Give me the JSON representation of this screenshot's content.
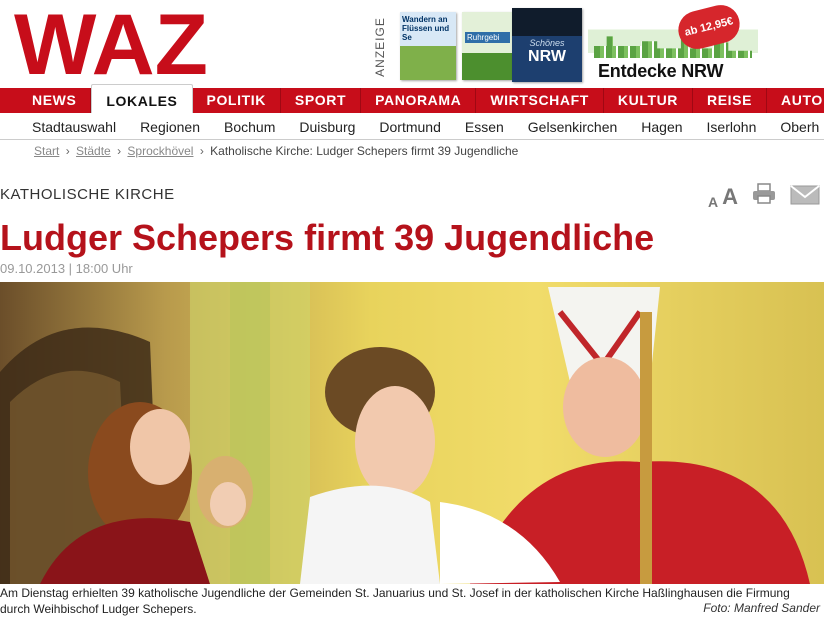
{
  "logo": {
    "text": "WAZ",
    "color": "#c70d1a"
  },
  "ad": {
    "label": "ANZEIGE",
    "book1_title": "Wandern an Flüssen und Se",
    "book2_title": "Ruhrgebi",
    "book3_subtitle": "Schönes",
    "book3_title": "NRW",
    "badge": "ab 12,95€",
    "claim": "Entdecke NRW"
  },
  "nav": {
    "items": [
      "NEWS",
      "LOKALES",
      "POLITIK",
      "SPORT",
      "PANORAMA",
      "WIRTSCHAFT",
      "KULTUR",
      "REISE",
      "AUTO"
    ],
    "active": "LOKALES"
  },
  "subnav": {
    "items": [
      "Stadtauswahl",
      "Regionen",
      "Bochum",
      "Duisburg",
      "Dortmund",
      "Essen",
      "Gelsenkirchen",
      "Hagen",
      "Iserlohn",
      "Oberh"
    ]
  },
  "breadcrumb": {
    "start": "Start",
    "staedte": "Städte",
    "city": "Sprockhövel",
    "current": "Katholische Kirche: Ludger Schepers firmt 39 Jugendliche",
    "separator": "›"
  },
  "article": {
    "kicker": "KATHOLISCHE KIRCHE",
    "headline": "Ludger Schepers firmt 39 Jugendliche",
    "date": "09.10.2013 | 18:00 Uhr",
    "caption": "Am Dienstag erhielten 39 katholische Jugendliche der Gemeinden St. Januarius und St. Josef in der katholischen Kirche Haßlinghausen die Firmung durch Weihbischof Ludger Schepers.",
    "credit": "Foto: Manfred Sander",
    "headline_color": "#b5121b"
  },
  "tools": {
    "font_small": "A",
    "font_large": "A",
    "print_icon": "printer-icon",
    "mail_icon": "mail-icon"
  }
}
